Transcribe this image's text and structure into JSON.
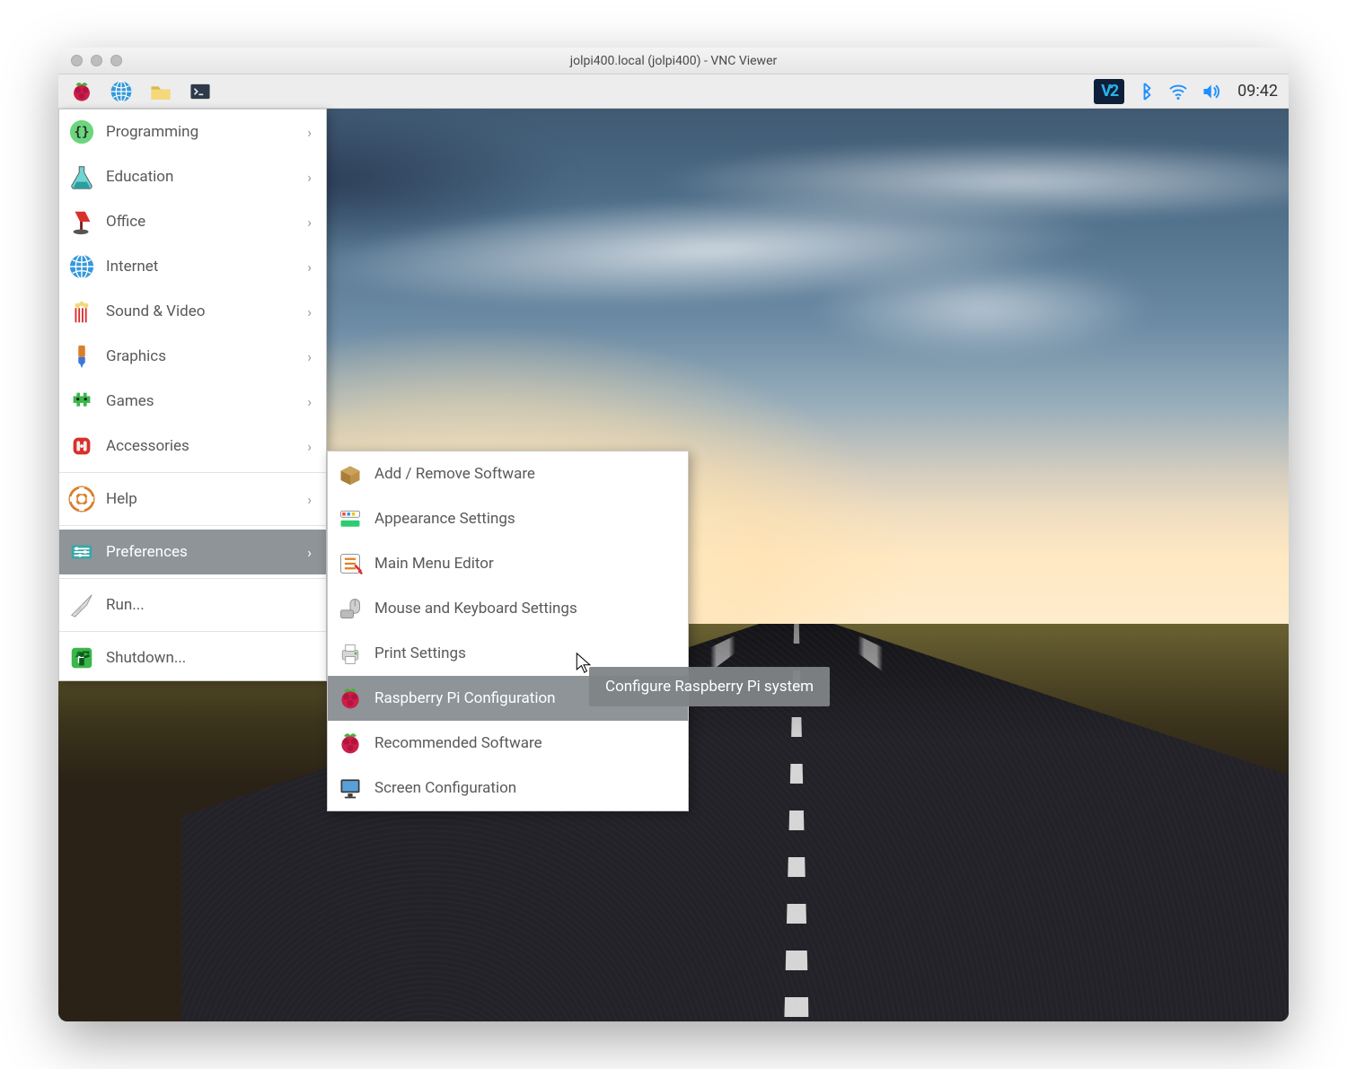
{
  "window": {
    "title": "jolpi400.local (jolpi400) - VNC Viewer"
  },
  "panel": {
    "clock": "09:42",
    "vnc_text": "V2"
  },
  "menu": {
    "items": [
      {
        "label": "Programming",
        "icon": "code"
      },
      {
        "label": "Education",
        "icon": "flask"
      },
      {
        "label": "Office",
        "icon": "lamp"
      },
      {
        "label": "Internet",
        "icon": "globe"
      },
      {
        "label": "Sound & Video",
        "icon": "popcorn"
      },
      {
        "label": "Graphics",
        "icon": "brush"
      },
      {
        "label": "Games",
        "icon": "invader"
      },
      {
        "label": "Accessories",
        "icon": "knife"
      }
    ],
    "help": {
      "label": "Help"
    },
    "preferences": {
      "label": "Preferences"
    },
    "run": {
      "label": "Run..."
    },
    "shutdown": {
      "label": "Shutdown..."
    }
  },
  "submenu": {
    "items": [
      {
        "label": "Add / Remove Software",
        "name": "add-remove-software",
        "icon": "box"
      },
      {
        "label": "Appearance Settings",
        "name": "appearance-settings",
        "icon": "palette"
      },
      {
        "label": "Main Menu Editor",
        "name": "main-menu-editor",
        "icon": "list"
      },
      {
        "label": "Mouse and Keyboard Settings",
        "name": "mouse-keyboard",
        "icon": "mouse"
      },
      {
        "label": "Print Settings",
        "name": "print-settings",
        "icon": "printer"
      },
      {
        "label": "Raspberry Pi Configuration",
        "name": "rpi-config",
        "icon": "rpi",
        "hover": true
      },
      {
        "label": "Recommended Software",
        "name": "recommended-software",
        "icon": "rpi"
      },
      {
        "label": "Screen Configuration",
        "name": "screen-config",
        "icon": "monitor"
      }
    ]
  },
  "tooltip": {
    "text": "Configure Raspberry Pi system"
  }
}
